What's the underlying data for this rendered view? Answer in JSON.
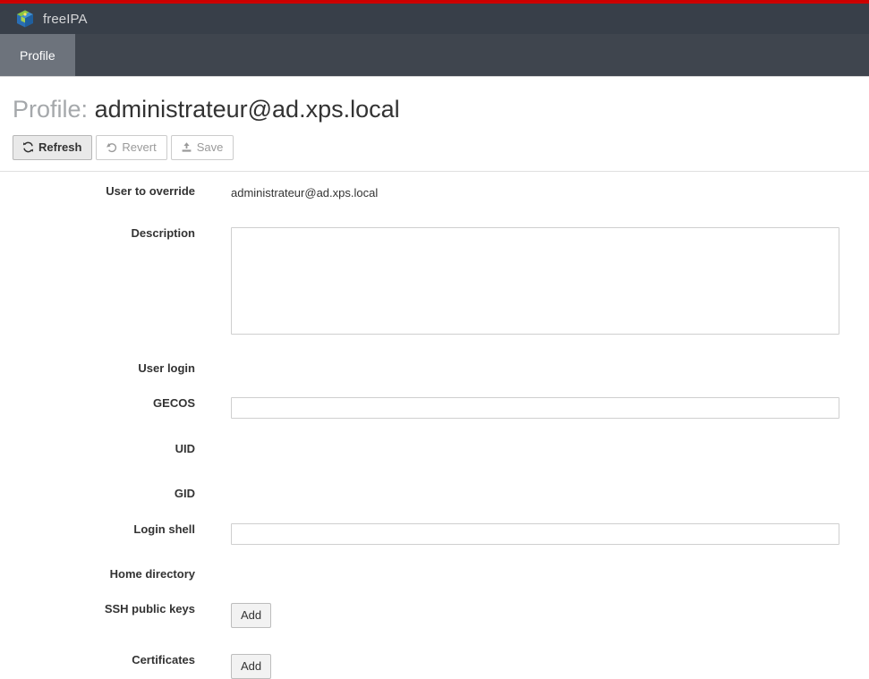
{
  "app": {
    "brand_name": "freeIPA",
    "logo_icon": "cube-logo-icon",
    "accent_color": "#cc0000",
    "masthead_color": "#383f49",
    "navbar_color": "#3f454e",
    "active_tab_color": "#6d737c"
  },
  "nav": {
    "tabs": [
      {
        "label": "Profile",
        "active": true
      }
    ]
  },
  "page": {
    "title_prefix": "Profile:",
    "title_value": "administrateur@ad.xps.local"
  },
  "toolbar": {
    "refresh_label": "Refresh",
    "refresh_icon": "refresh-icon",
    "revert_label": "Revert",
    "revert_icon": "undo-icon",
    "save_label": "Save",
    "save_icon": "upload-icon"
  },
  "form": {
    "rows": [
      {
        "label": "User to override",
        "type": "static",
        "value": "administrateur@ad.xps.local"
      },
      {
        "label": "Description",
        "type": "textarea",
        "value": "",
        "placeholder": ""
      },
      {
        "label": "User login",
        "type": "empty",
        "value": ""
      },
      {
        "label": "GECOS",
        "type": "text",
        "value": "",
        "placeholder": ""
      },
      {
        "label": "UID",
        "type": "empty",
        "value": ""
      },
      {
        "label": "GID",
        "type": "empty",
        "value": ""
      },
      {
        "label": "Login shell",
        "type": "text",
        "value": "",
        "placeholder": ""
      },
      {
        "label": "Home directory",
        "type": "empty",
        "value": ""
      },
      {
        "label": "SSH public keys",
        "type": "button",
        "value": "Add"
      },
      {
        "label": "Certificates",
        "type": "button",
        "value": "Add"
      }
    ]
  }
}
